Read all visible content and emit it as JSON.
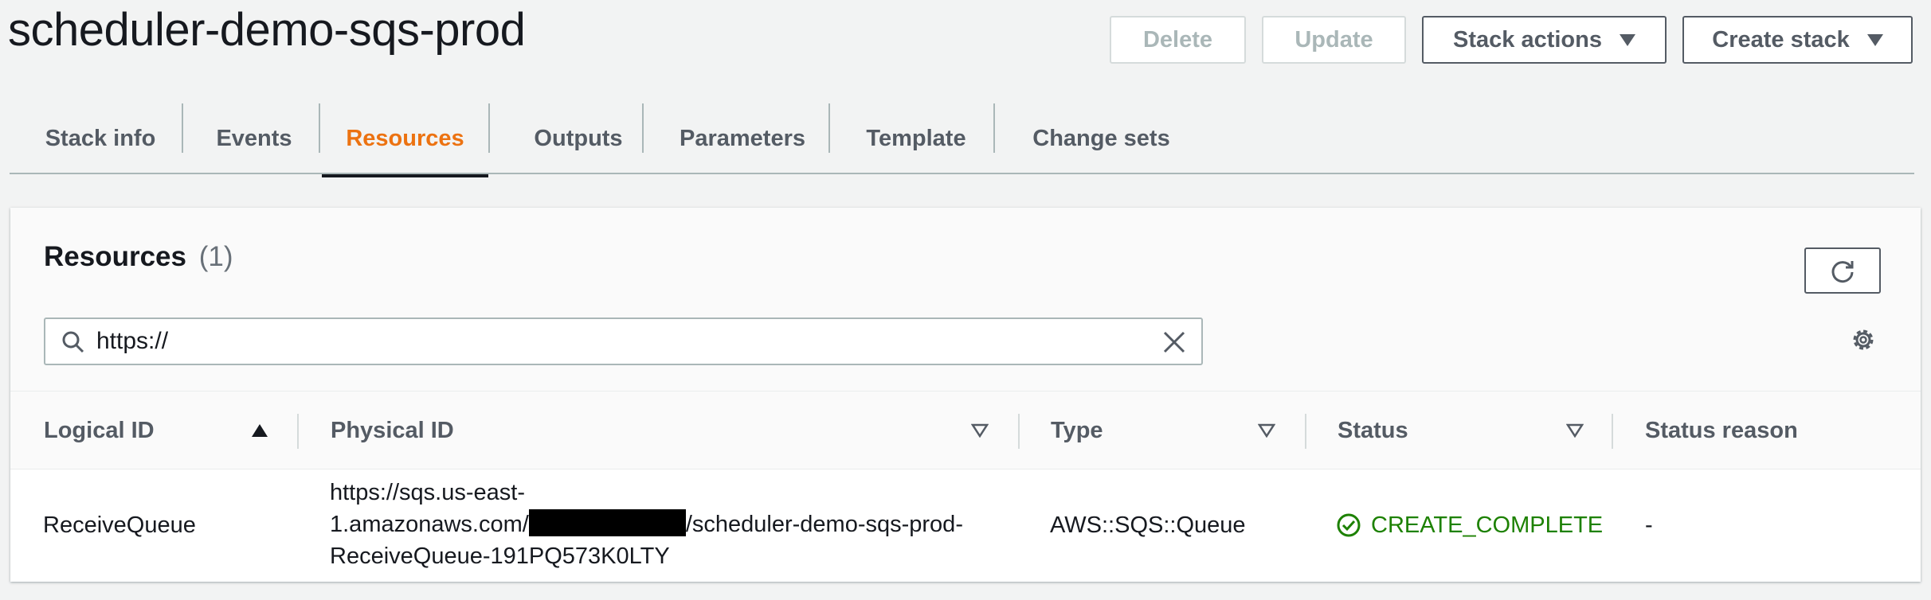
{
  "page": {
    "title": "scheduler-demo-sqs-prod"
  },
  "actions": {
    "delete": "Delete",
    "update": "Update",
    "stack_actions": "Stack actions",
    "create_stack": "Create stack"
  },
  "tabs": [
    {
      "label": "Stack info",
      "active": false
    },
    {
      "label": "Events",
      "active": false
    },
    {
      "label": "Resources",
      "active": true
    },
    {
      "label": "Outputs",
      "active": false
    },
    {
      "label": "Parameters",
      "active": false
    },
    {
      "label": "Template",
      "active": false
    },
    {
      "label": "Change sets",
      "active": false
    }
  ],
  "resources": {
    "title": "Resources",
    "count": "(1)",
    "search_value": "https://",
    "columns": [
      "Logical ID",
      "Physical ID",
      "Type",
      "Status",
      "Status reason"
    ],
    "rows": [
      {
        "logical_id": "ReceiveQueue",
        "physical_id_line1": "https://sqs.us-east-",
        "physical_id_line2_prefix": "1.amazonaws.com/",
        "physical_id_line2_suffix": "/scheduler-demo-sqs-prod-",
        "physical_id_line3": "ReceiveQueue-191PQ573K0LTY",
        "type": "AWS::SQS::Queue",
        "status": "CREATE_COMPLETE",
        "status_reason": "-"
      }
    ]
  },
  "colors": {
    "accent_tab": "#ec7211",
    "status_success": "#1d8102",
    "text_primary": "#16191f",
    "text_secondary": "#545b64"
  }
}
